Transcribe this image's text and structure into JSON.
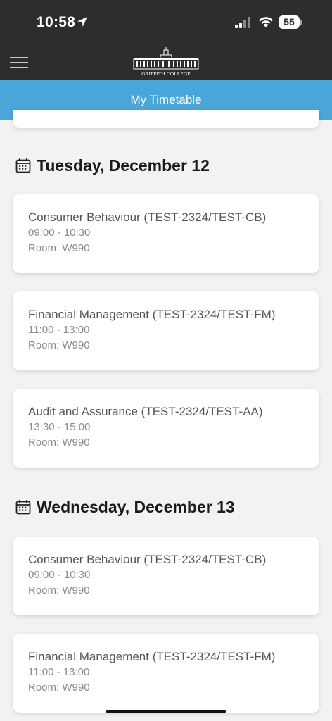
{
  "status_bar": {
    "time": "10:58",
    "battery": "55"
  },
  "header": {
    "logo_text": "GRIFFITH COLLEGE"
  },
  "title_bar": {
    "title": "My Timetable"
  },
  "days": [
    {
      "title": "Tuesday, December 12",
      "events": [
        {
          "title": "Consumer Behaviour (TEST-2324/TEST-CB)",
          "time": "09:00 - 10:30",
          "room": "Room: W990"
        },
        {
          "title": "Financial Management (TEST-2324/TEST-FM)",
          "time": "11:00 - 13:00",
          "room": "Room: W990"
        },
        {
          "title": "Audit and Assurance (TEST-2324/TEST-AA)",
          "time": "13:30 - 15:00",
          "room": "Room: W990"
        }
      ]
    },
    {
      "title": "Wednesday, December 13",
      "events": [
        {
          "title": "Consumer Behaviour (TEST-2324/TEST-CB)",
          "time": "09:00 - 10:30",
          "room": "Room: W990"
        },
        {
          "title": "Financial Management (TEST-2324/TEST-FM)",
          "time": "11:00 - 13:00",
          "room": "Room: W990"
        }
      ]
    }
  ],
  "colors": {
    "header_bg": "#2d2d2d",
    "accent": "#4aa6d8",
    "page_bg": "#f2f2f2"
  }
}
